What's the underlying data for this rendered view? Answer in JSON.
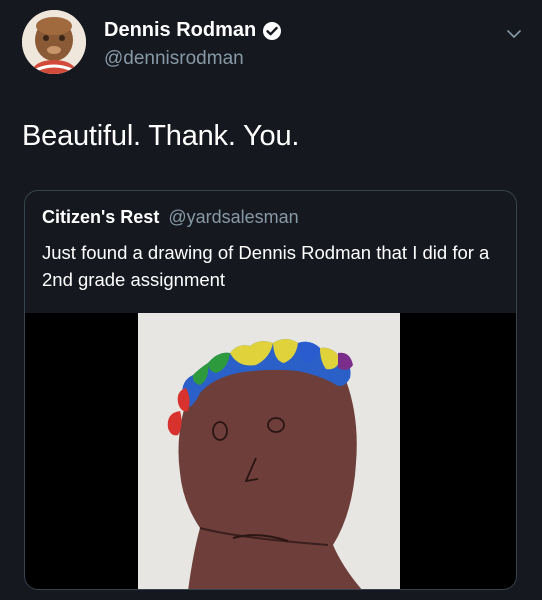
{
  "author": {
    "display_name": "Dennis Rodman",
    "handle": "@dennisrodman",
    "verified": true,
    "avatar_icon": "profile-avatar"
  },
  "tweet": {
    "text": "Beautiful. Thank. You."
  },
  "quoted_tweet": {
    "display_name": "Citizen's Rest",
    "handle": "@yardsalesman",
    "text": "Just found a drawing of Dennis Rodman that I did for a 2nd grade assignment",
    "media_icon": "crayon-drawing-image"
  },
  "icons": {
    "verified": "verified-badge-icon",
    "menu": "chevron-down-icon"
  },
  "colors": {
    "background": "#15181f",
    "text": "#ffffff",
    "secondary_text": "#8899a6",
    "border": "#38444d"
  }
}
